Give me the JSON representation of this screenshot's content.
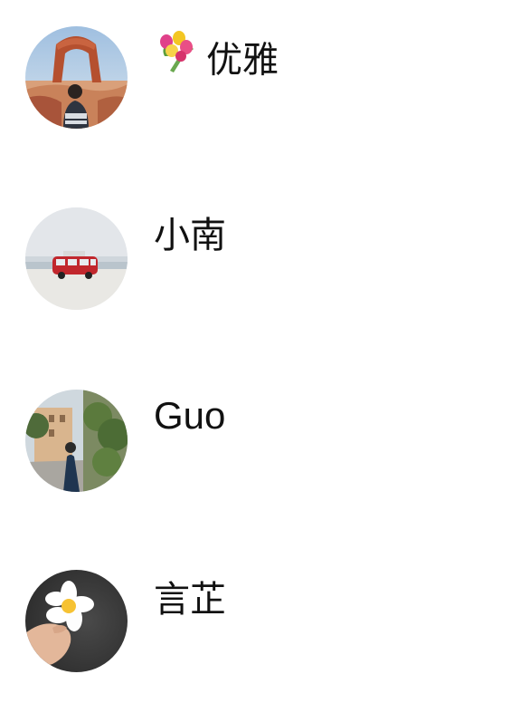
{
  "contacts": [
    {
      "name": "优雅",
      "emoji_icon": "bouquet-icon",
      "avatar": "red-rock-arch-photo"
    },
    {
      "name": "小南",
      "avatar": "red-van-on-beach-photo"
    },
    {
      "name": "Guo",
      "avatar": "street-with-person-photo"
    },
    {
      "name": "言芷",
      "avatar": "hand-holding-flower-photo"
    }
  ],
  "colors": {
    "background": "#ffffff",
    "divider": "#e6e6e6",
    "text": "#111111"
  }
}
